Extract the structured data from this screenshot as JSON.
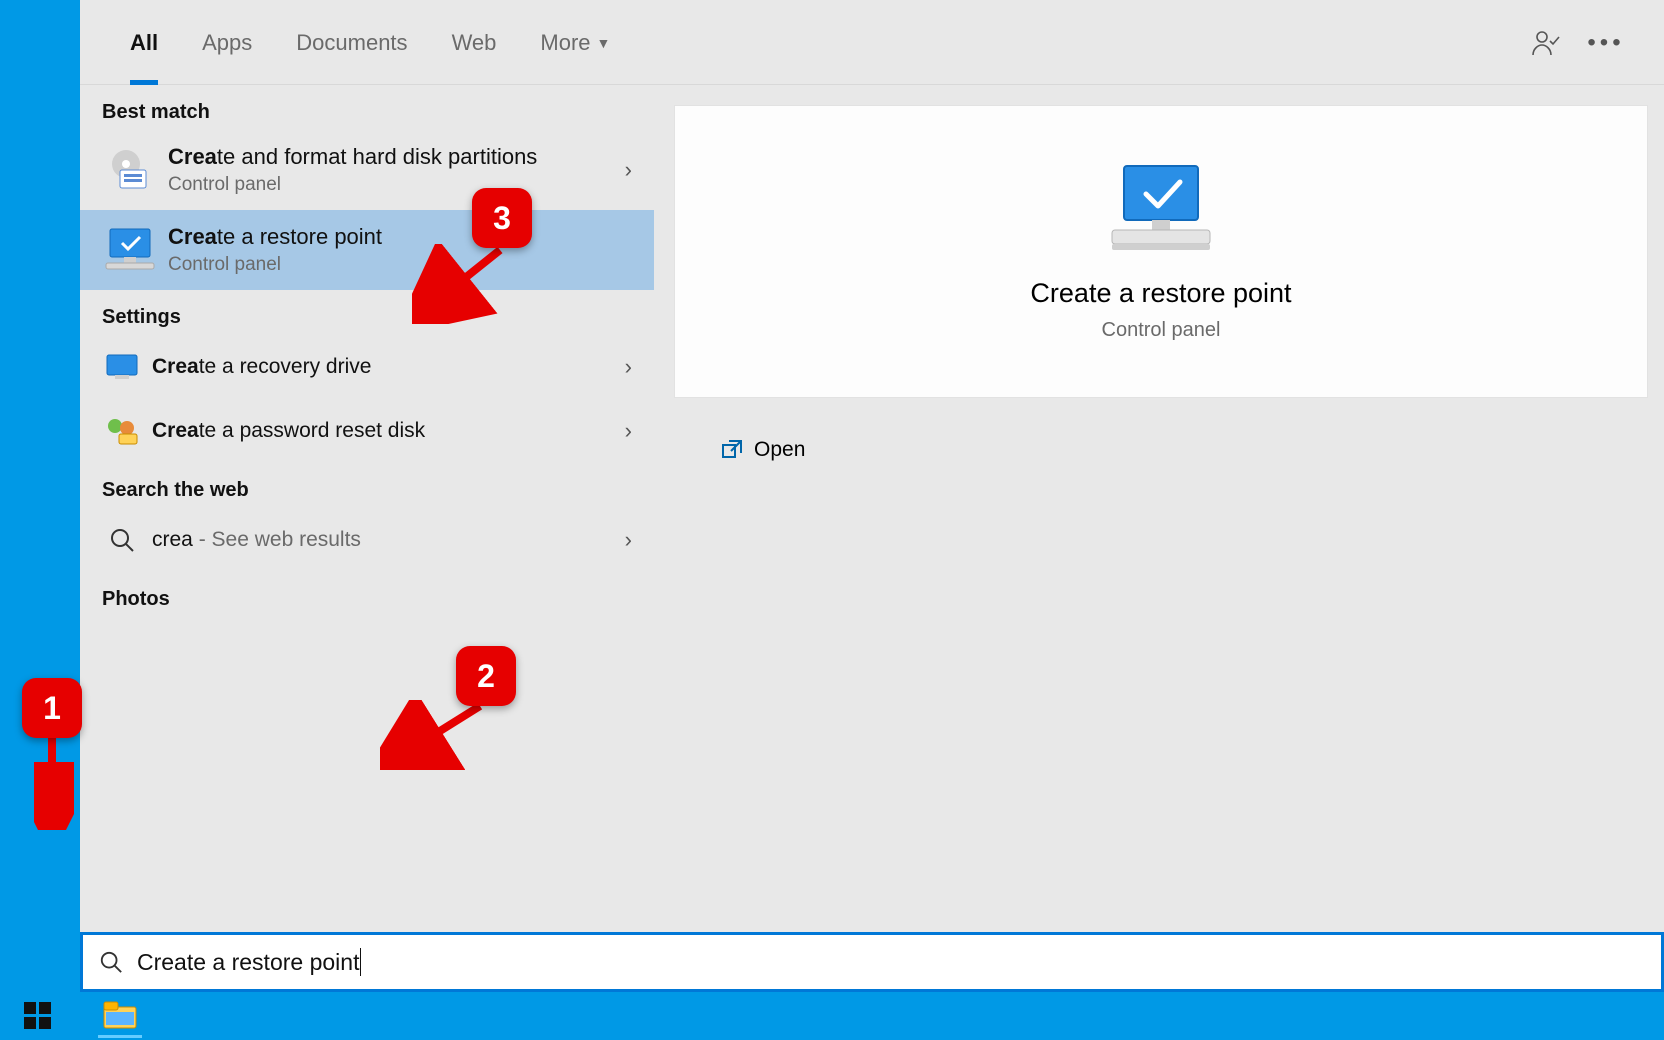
{
  "tabs": {
    "all": "All",
    "apps": "Apps",
    "documents": "Documents",
    "web": "Web",
    "more": "More"
  },
  "sections": {
    "best_match": "Best match",
    "settings": "Settings",
    "search_web": "Search the web",
    "photos": "Photos"
  },
  "results": {
    "r1": {
      "bold": "Crea",
      "rest": "te and format hard disk partitions",
      "sub": "Control panel"
    },
    "r2": {
      "bold": "Crea",
      "rest": "te a restore point",
      "sub": "Control panel"
    },
    "r3": {
      "bold": "Crea",
      "rest": "te a recovery drive"
    },
    "r4": {
      "bold": "Crea",
      "rest": "te a password reset disk"
    },
    "web": {
      "query": "crea",
      "suffix": " - See web results"
    }
  },
  "detail": {
    "title": "Create a restore point",
    "sub": "Control panel",
    "open": "Open"
  },
  "search": {
    "value": "Create a restore point"
  },
  "callouts": {
    "c1": "1",
    "c2": "2",
    "c3": "3"
  }
}
